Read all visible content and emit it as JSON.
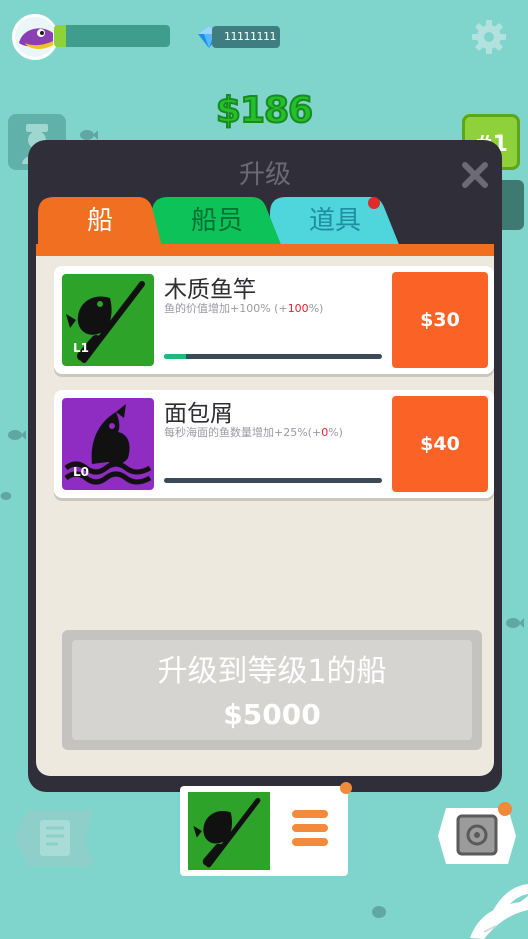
{
  "hud": {
    "xp_fraction": 0.1,
    "gems_text": "11111111",
    "money": "$186",
    "rank": "#1"
  },
  "panel": {
    "title": "升级",
    "tabs": [
      {
        "label": "船",
        "active": true
      },
      {
        "label": "船员",
        "active": false
      },
      {
        "label": "道具",
        "active": false,
        "notification": true
      }
    ]
  },
  "upgrades": [
    {
      "title": "木质鱼竿",
      "desc_prefix": "鱼的价值增加",
      "desc_inc": "+100%",
      "desc_open": " (+",
      "desc_red": "100",
      "desc_close": "%)",
      "level": "L1",
      "progress_fraction": 0.1,
      "price": "$30"
    },
    {
      "title": "面包屑",
      "desc_prefix": "每秒海面的鱼数量增加",
      "desc_inc": "+25%",
      "desc_open": "(+",
      "desc_red": "0",
      "desc_close": "%)",
      "level": "L0",
      "progress_fraction": 0,
      "price": "$40"
    }
  ],
  "boat_upgrade": {
    "title": "升级到等级1的船",
    "price": "$5000"
  },
  "colors": {
    "background": "#7fd4cc",
    "money_green": "#22c02b",
    "buy_orange": "#fb6326",
    "tab_orange": "#f16f21",
    "tab_green": "#0ec25a",
    "tab_cyan": "#4fd5dc",
    "rod_icon_bg": "#2da32a",
    "bread_icon_bg": "#8f2cc2"
  },
  "icons": {
    "avatar": "purple-fish-avatar-icon",
    "gem": "blue-diamond-icon",
    "settings": "gear-icon",
    "close": "close-x-icon",
    "rod": "fishing-rod-icon",
    "bread": "jumping-fish-icon",
    "menu": "hamburger-icon",
    "safe": "safe-icon"
  }
}
